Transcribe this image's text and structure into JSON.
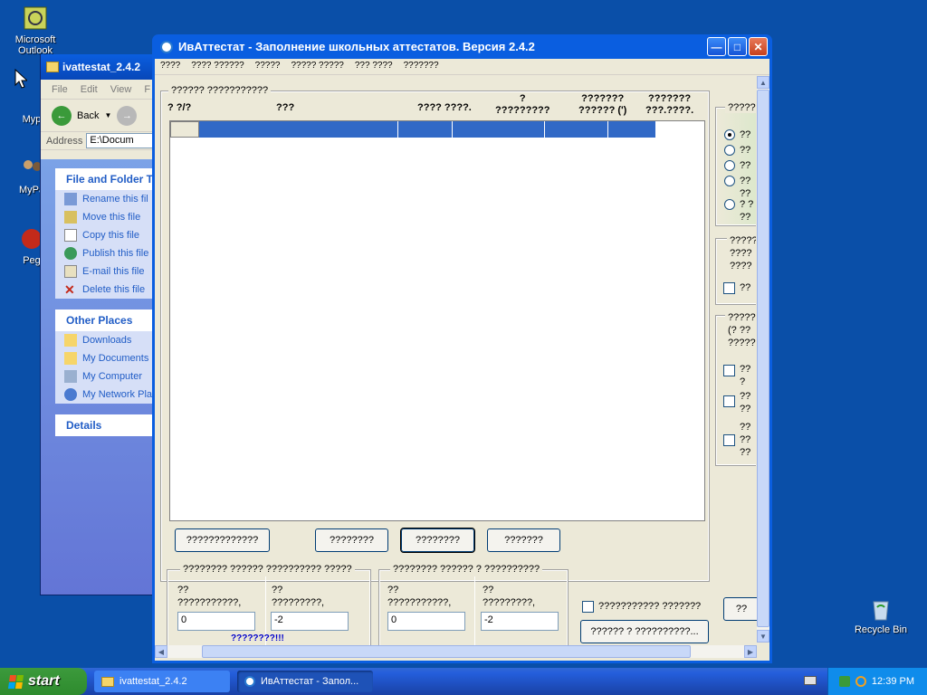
{
  "desktop": {
    "icons": [
      {
        "label": "Microsoft\nOutlook"
      },
      {
        "label": "Myp"
      },
      {
        "label": "MyPa"
      },
      {
        "label": "Peg"
      },
      {
        "label": "Recycle Bin"
      }
    ]
  },
  "explorer": {
    "title": "ivattestat_2.4.2",
    "menu": [
      "File",
      "Edit",
      "View",
      "F"
    ],
    "back_label": "Back",
    "address_label": "Address",
    "address_value": "E:\\Docum",
    "file_tasks_title": "File and Folder Ta",
    "file_tasks": [
      "Rename this fil",
      "Move this file",
      "Copy this file",
      "Publish this file",
      "E-mail this file",
      "Delete this file"
    ],
    "other_places_title": "Other Places",
    "other_places": [
      "Downloads",
      "My Documents",
      "My Computer",
      "My Network Pla"
    ],
    "details_title": "Details"
  },
  "main": {
    "title": "ИвАттестат - Заполнение школьных аттестатов. Версия 2.4.2",
    "menu": [
      "????",
      "???? ??????",
      "?????",
      "????? ?????",
      "??? ????",
      "???????"
    ],
    "grid_group_label": "?????? ???????????",
    "columns": [
      "? ?/?",
      "???",
      "???? ????.",
      "?\n?????????",
      "???????\n?????? (')",
      "???????\n???.????."
    ],
    "buttons": [
      "?????????????",
      "????????",
      "????????",
      "???????"
    ],
    "bottom_left_group": "???????? ?????? ?????????? ?????",
    "bottom_right_group": "???????? ?????? ? ??????????",
    "field_labels": [
      "??\n???????????,",
      "??\n?????????,",
      "??\n???????????,",
      "??\n?????????,"
    ],
    "field_values": [
      "0",
      "-2",
      "0",
      "-2"
    ],
    "warning_text": "????????!!!",
    "checkbox_label": "??????????? ???????",
    "bottom_button": "?????? ? ??????????...",
    "edge_button": "??",
    "right_panel": {
      "group1_label": "?????",
      "radio_labels": [
        "??",
        "??",
        "??",
        "??\n??",
        "? ?\n??"
      ],
      "group2_label": "?????\n????\n????",
      "group2_check": "??",
      "group3_label": "?????\n(? ??\n?????",
      "group3_checks": [
        "??\n?",
        "??\n??",
        "??\n??\n??"
      ]
    }
  },
  "taskbar": {
    "start_label": "start",
    "tasks": [
      "ivattestat_2.4.2",
      "ИвАттестат - Запол..."
    ],
    "clock": "12:39 PM"
  }
}
